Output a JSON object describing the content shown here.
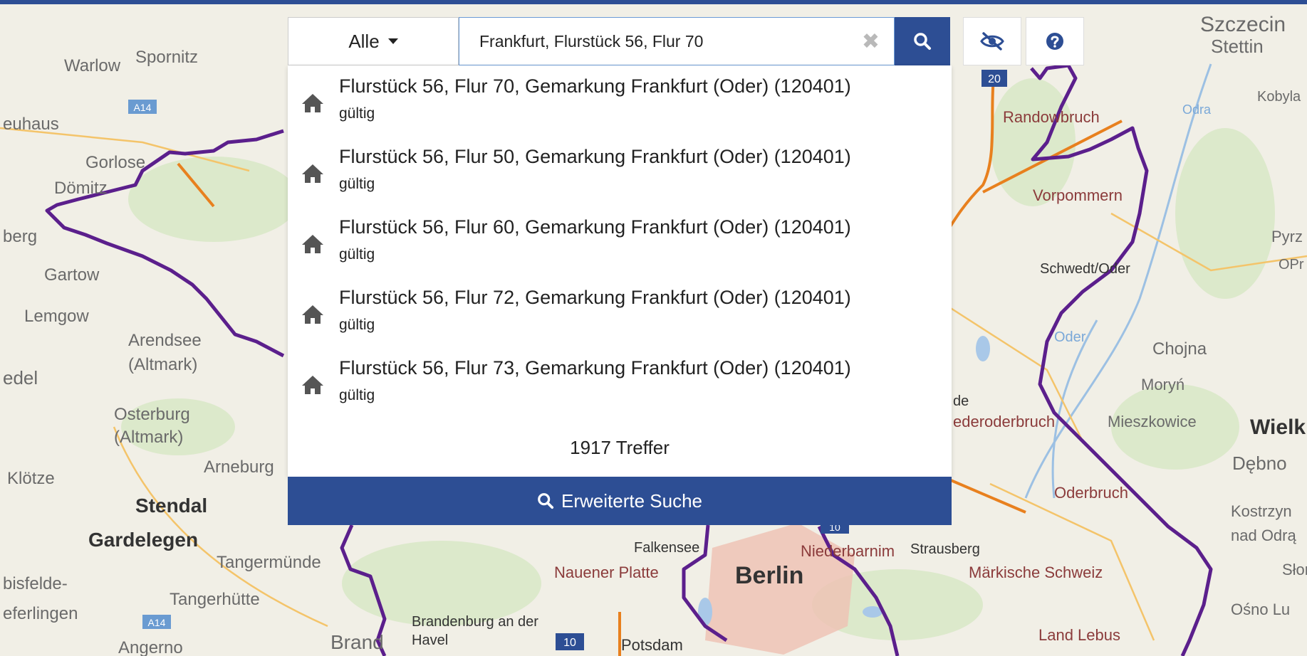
{
  "search": {
    "filter_label": "Alle",
    "query": "Frankfurt, Flurstück 56, Flur 70"
  },
  "results": [
    {
      "title": "Flurstück 56, Flur 70, Gemarkung Frankfurt (Oder) (120401)",
      "status": "gültig"
    },
    {
      "title": "Flurstück 56, Flur 50, Gemarkung Frankfurt (Oder) (120401)",
      "status": "gültig"
    },
    {
      "title": "Flurstück 56, Flur 60, Gemarkung Frankfurt (Oder) (120401)",
      "status": "gültig"
    },
    {
      "title": "Flurstück 56, Flur 72, Gemarkung Frankfurt (Oder) (120401)",
      "status": "gültig"
    },
    {
      "title": "Flurstück 56, Flur 73, Gemarkung Frankfurt (Oder) (120401)",
      "status": "gültig"
    }
  ],
  "result_count": "1917 Treffer",
  "advanced_search_label": "Erweiterte Suche",
  "colors": {
    "accent": "#2d4e94",
    "border": "#5b1f8c",
    "motorway": "#e8801e",
    "city_area": "#efc0b3"
  },
  "map": {
    "labels": [
      "Warlow",
      "Spornitz",
      "euhaus",
      "Gorlose",
      "Dömitz",
      "berg",
      "Gartow",
      "Lemgow",
      "Arendsee",
      "(Altmark)",
      "edel",
      "Osterburg",
      "(Altmark)",
      "Klötze",
      "Arneburg",
      "Stendal",
      "Gardelegen",
      "Tangermünde",
      "bisfelde-",
      "eferlingen",
      "Tangerhütte",
      "Angerno",
      "Brand",
      "Brandenburg an der",
      "Havel",
      "Falkensee",
      "Nauener Platte",
      "Berlin",
      "Potsdam",
      "Niederbarnim",
      "Strausberg",
      "Märkische Schweiz",
      "Land Lebus",
      "Oderbruch",
      "ederoderbruch",
      "de",
      "Mieszkowice",
      "Moryń",
      "Chojna",
      "Schwedt/Oder",
      "Vorpommern",
      "Randowbruch",
      "Szczecin",
      "Stettin",
      "Kobyla",
      "Pyrz",
      "OPr",
      "Wielk",
      "Dębno",
      "Kostrzyn",
      "nad Odrą",
      "Słońsk",
      "Ośno Lu",
      "Oder",
      "Odra"
    ],
    "road_shields": [
      "A14",
      "A14",
      "20",
      "10",
      "10"
    ]
  }
}
